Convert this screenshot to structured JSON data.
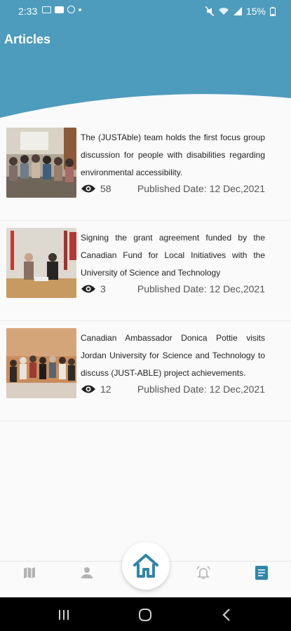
{
  "status_bar": {
    "time": "2:33",
    "battery": "15%"
  },
  "header": {
    "title": "Articles"
  },
  "articles": [
    {
      "text": "The (JUSTAble) team holds the first focus group discussion for people with disabilities regarding environmental accessibility.",
      "views": "58",
      "published": "Published Date: 12 Dec,2021"
    },
    {
      "text": "Signing the grant agreement funded by the Canadian Fund for Local Initiatives with the University of Science and Technology",
      "views": "3",
      "published": "Published Date: 12 Dec,2021"
    },
    {
      "text": "Canadian Ambassador Donica Pottie visits Jordan University for Science and Technology to discuss (JUST-ABLE) project achievements.",
      "views": "12",
      "published": "Published Date: 12 Dec,2021"
    }
  ],
  "colors": {
    "accent": "#4d9bbd",
    "active_icon": "#2f86a8",
    "inactive_icon": "#b3b3b3"
  }
}
